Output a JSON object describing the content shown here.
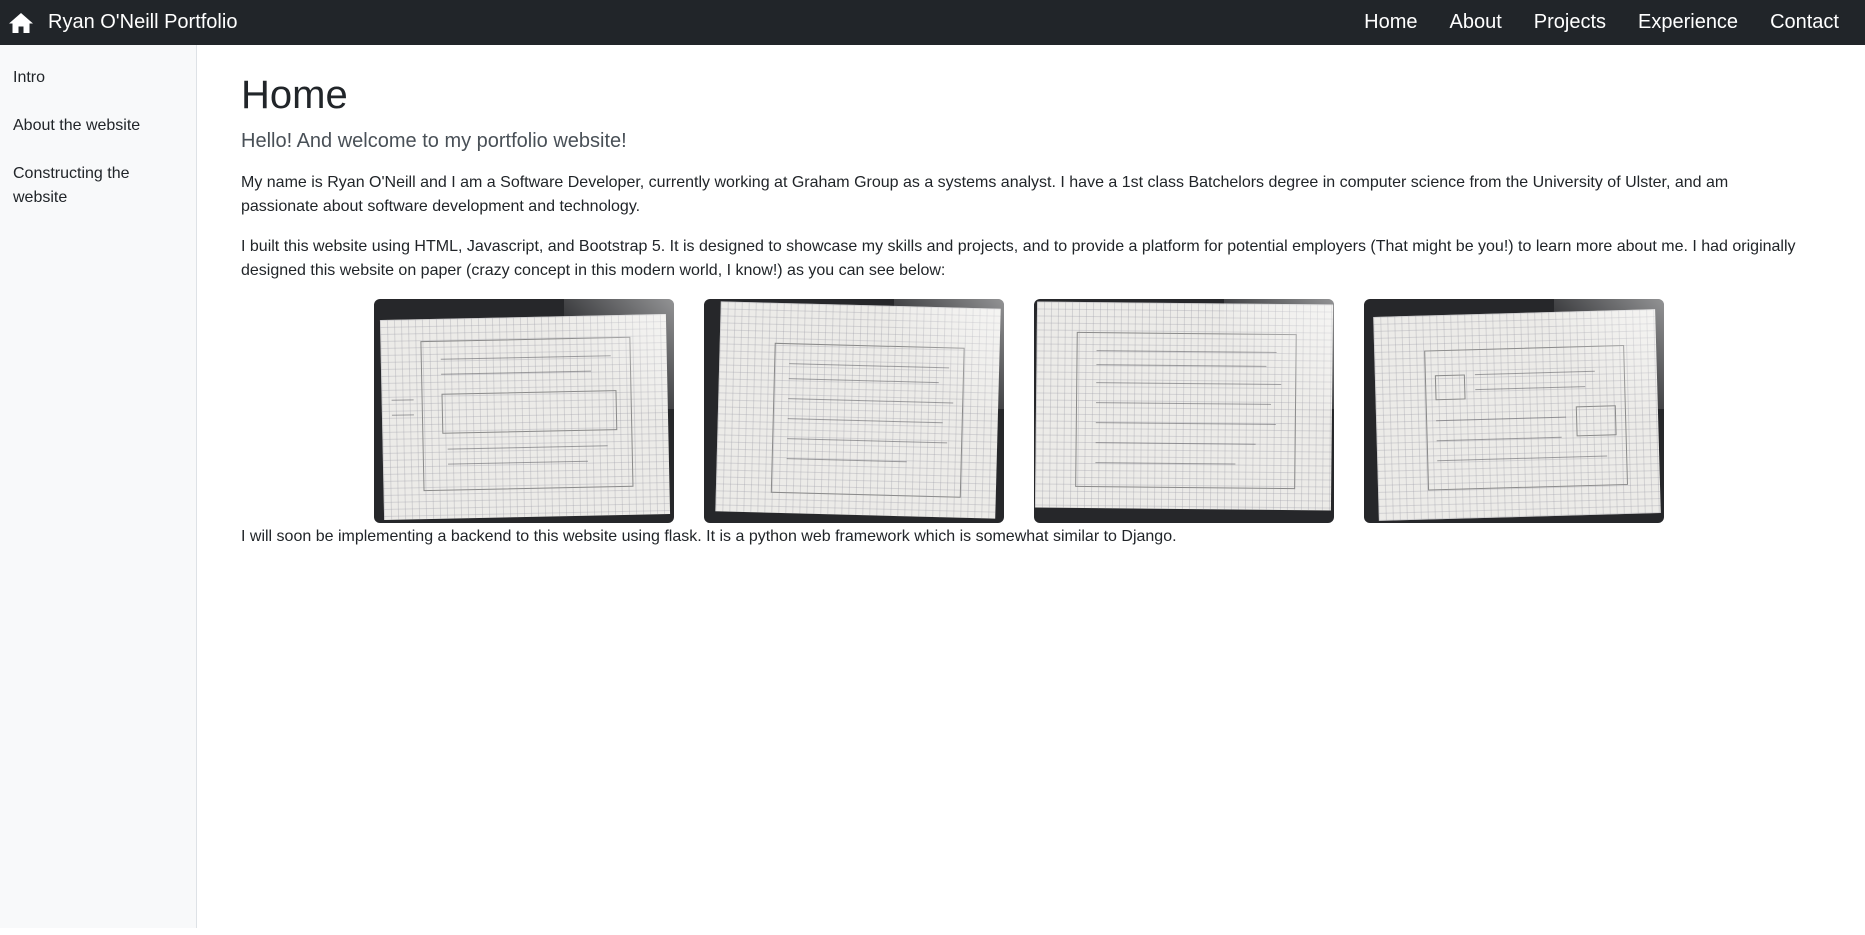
{
  "navbar": {
    "brand": "Ryan O'Neill Portfolio",
    "brand_icon": "home-icon",
    "links": [
      "Home",
      "About",
      "Projects",
      "Experience",
      "Contact"
    ]
  },
  "sidebar": {
    "items": [
      "Intro",
      "About the website",
      "Constructing the website"
    ]
  },
  "main": {
    "title": "Home",
    "lead": "Hello! And welcome to my portfolio website!",
    "paragraphs": [
      "My name is Ryan O'Neill and I am a Software Developer, currently working at Graham Group as a systems analyst. I have a 1st class Batchelors degree in computer science from the University of Ulster, and am passionate about software development and technology.",
      "I built this website using HTML, Javascript, and Bootstrap 5. It is designed to showcase my skills and projects, and to provide a platform for potential employers (That might be you!) to learn more about me. I had originally designed this website on paper (crazy concept in this modern world, I know!) as you can see below:",
      "I will soon be implementing a backend to this website using flask. It is a python web framework which is somewhat similar to Django."
    ]
  },
  "colors": {
    "navbar_bg": "#212529",
    "sidebar_bg": "#f8f9fa",
    "text": "#212529",
    "lead_text": "#495057"
  }
}
